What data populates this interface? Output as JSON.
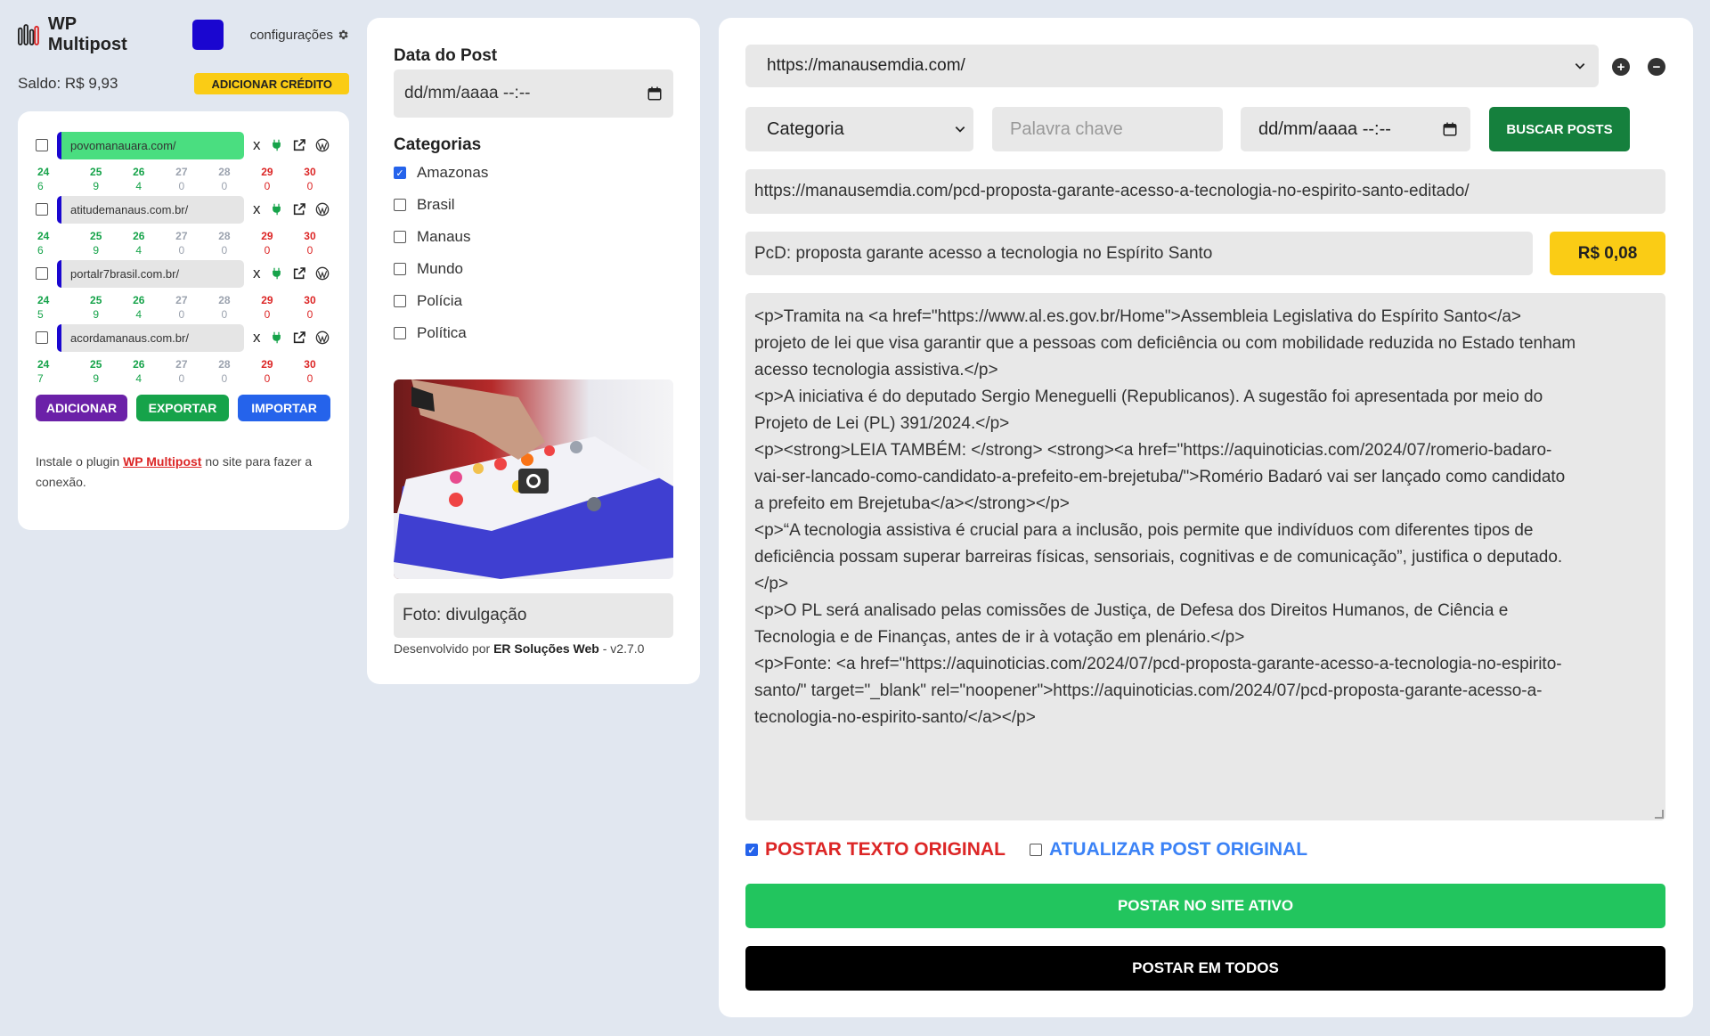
{
  "header": {
    "app_title": "WP Multipost",
    "settings_label": "configurações",
    "brand_color": "#1a06d0"
  },
  "balance": {
    "text": "Saldo: R$ 9,93",
    "add_credit_label": "ADICIONAR CRÉDITO"
  },
  "sites": [
    {
      "url": "povomanauara.com/",
      "active": true,
      "days": [
        {
          "d": "24",
          "n": "6",
          "color": "green"
        },
        {
          "d": "25",
          "n": "9",
          "color": "green"
        },
        {
          "d": "26",
          "n": "4",
          "color": "green"
        },
        {
          "d": "27",
          "n": "0",
          "color": "gray"
        },
        {
          "d": "28",
          "n": "0",
          "color": "gray"
        },
        {
          "d": "29",
          "n": "0",
          "color": "red"
        },
        {
          "d": "30",
          "n": "0",
          "color": "red"
        }
      ]
    },
    {
      "url": "atitudemanaus.com.br/",
      "active": false,
      "days": [
        {
          "d": "24",
          "n": "6",
          "color": "green"
        },
        {
          "d": "25",
          "n": "9",
          "color": "green"
        },
        {
          "d": "26",
          "n": "4",
          "color": "green"
        },
        {
          "d": "27",
          "n": "0",
          "color": "gray"
        },
        {
          "d": "28",
          "n": "0",
          "color": "gray"
        },
        {
          "d": "29",
          "n": "0",
          "color": "red"
        },
        {
          "d": "30",
          "n": "0",
          "color": "red"
        }
      ]
    },
    {
      "url": "portalr7brasil.com.br/",
      "active": false,
      "days": [
        {
          "d": "24",
          "n": "5",
          "color": "green"
        },
        {
          "d": "25",
          "n": "9",
          "color": "green"
        },
        {
          "d": "26",
          "n": "4",
          "color": "green"
        },
        {
          "d": "27",
          "n": "0",
          "color": "gray"
        },
        {
          "d": "28",
          "n": "0",
          "color": "gray"
        },
        {
          "d": "29",
          "n": "0",
          "color": "red"
        },
        {
          "d": "30",
          "n": "0",
          "color": "red"
        }
      ]
    },
    {
      "url": "acordamanaus.com.br/",
      "active": false,
      "days": [
        {
          "d": "24",
          "n": "7",
          "color": "green"
        },
        {
          "d": "25",
          "n": "9",
          "color": "green"
        },
        {
          "d": "26",
          "n": "4",
          "color": "green"
        },
        {
          "d": "27",
          "n": "0",
          "color": "gray"
        },
        {
          "d": "28",
          "n": "0",
          "color": "gray"
        },
        {
          "d": "29",
          "n": "0",
          "color": "red"
        },
        {
          "d": "30",
          "n": "0",
          "color": "red"
        }
      ]
    }
  ],
  "site_actions": {
    "remove_label": "x",
    "add_label": "ADICIONAR",
    "export_label": "EXPORTAR",
    "import_label": "IMPORTAR"
  },
  "install_note": {
    "before": "Instale o plugin ",
    "link": "WP Multipost",
    "after": " no site para fazer a conexão."
  },
  "post_form": {
    "date_label": "Data do Post",
    "date_placeholder": "dd/mm/aaaa --:--",
    "categories_label": "Categorias",
    "categories": [
      {
        "label": "Amazonas",
        "checked": true
      },
      {
        "label": "Brasil",
        "checked": false
      },
      {
        "label": "Manaus",
        "checked": false
      },
      {
        "label": "Mundo",
        "checked": false
      },
      {
        "label": "Polícia",
        "checked": false
      },
      {
        "label": "Política",
        "checked": false
      }
    ],
    "caption": "Foto: divulgação",
    "footer_before": "Desenvolvido por ",
    "footer_brand": "ER Soluções Web",
    "footer_after": " - v2.7.0"
  },
  "editor": {
    "source_url": "https://manausemdia.com/",
    "category_placeholder": "Categoria",
    "keyword_placeholder": "Palavra chave",
    "date_placeholder": "dd/mm/aaaa --:--",
    "search_label": "BUSCAR POSTS",
    "post_url": "https://manausemdia.com/pcd-proposta-garante-acesso-a-tecnologia-no-espirito-santo-editado/",
    "post_title": "PcD: proposta garante acesso a tecnologia no Espírito Santo",
    "price": "R$ 0,08",
    "content_lines": [
      "<p>Tramita na <a href=\"https://www.al.es.gov.br/Home\">Assembleia Legislativa do Espírito Santo</a>",
      "projeto de lei que visa garantir que a pessoas com deficiência ou com mobilidade reduzida no Estado tenham",
      "acesso tecnologia assistiva.</p>",
      "<p>A iniciativa é do deputado Sergio Meneguelli (Republicanos). A sugestão foi apresentada por meio do",
      "Projeto de Lei (PL) 391/2024.</p>",
      "<p><strong>LEIA TAMBÉM: </strong> <strong><a href=\"https://aquinoticias.com/2024/07/romerio-badaro-",
      "vai-ser-lancado-como-candidato-a-prefeito-em-brejetuba/\">Romério Badaró vai ser lançado como candidato",
      "a prefeito em Brejetuba</a></strong></p>",
      "<p>“A tecnologia assistiva é crucial para a inclusão, pois permite que indivíduos com diferentes tipos de",
      "deficiência possam superar barreiras físicas, sensoriais, cognitivas e de comunicação”, justifica o deputado.",
      "</p>",
      "<p>O PL será analisado pelas comissões de Justiça, de Defesa dos Direitos Humanos, de Ciência e",
      "Tecnologia e de Finanças, antes de ir à votação em plenário.</p>",
      "<p>Fonte: <a href=\"https://aquinoticias.com/2024/07/pcd-proposta-garante-acesso-a-tecnologia-no-espirito-",
      "santo/\" target=\"_blank\" rel=\"noopener\">https://aquinoticias.com/2024/07/pcd-proposta-garante-acesso-a-",
      "tecnologia-no-espirito-santo/</a></p>"
    ],
    "post_original_label": "POSTAR TEXTO ORIGINAL",
    "post_original_checked": true,
    "update_original_label": "ATUALIZAR POST ORIGINAL",
    "update_original_checked": false,
    "post_active_label": "POSTAR NO SITE ATIVO",
    "post_all_label": "POSTAR EM TODOS"
  }
}
